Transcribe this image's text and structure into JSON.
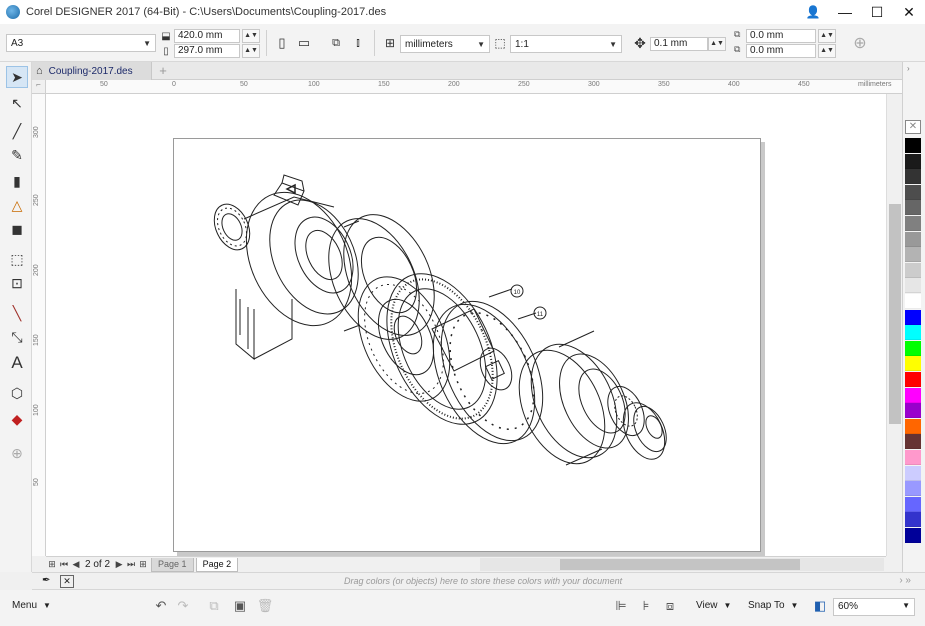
{
  "window": {
    "title": "Corel DESIGNER 2017 (64-Bit) - C:\\Users\\Documents\\Coupling-2017.des",
    "controls": {
      "minimize": "—",
      "maximize": "☐",
      "close": "✕"
    }
  },
  "property_bar": {
    "page_size": "A3",
    "width": "420.0 mm",
    "height": "297.0 mm",
    "units": "millimeters",
    "scale": "1:1",
    "nudge": "0.1 mm",
    "dup_x": "0.0 mm",
    "dup_y": "0.0 mm"
  },
  "toolbox": {
    "tools": [
      "pick-tool",
      "shape-tool",
      "line-tool",
      "artistic-media-tool",
      "fill-tool",
      "perspective-tool",
      "extrude-tool",
      "rectangle-tool",
      "crop-tool",
      "dimension-tool",
      "connector-tool",
      "text-tool",
      "projected-tool",
      "interactive-fill-tool",
      "add-tool"
    ]
  },
  "document": {
    "tab_label": "Coupling-2017.des"
  },
  "rulers": {
    "unit_label": "millimeters",
    "h_labels": [
      "50",
      "0",
      "50",
      "100",
      "150",
      "200",
      "250",
      "300",
      "350",
      "400",
      "450"
    ],
    "v_labels": [
      "300",
      "250",
      "200",
      "150",
      "100",
      "50"
    ]
  },
  "callouts": {
    "a": "10",
    "b": "11"
  },
  "page_nav": {
    "counter": "2 of 2",
    "pages": [
      "Page 1",
      "Page 2"
    ]
  },
  "color_bar": {
    "hint": "Drag colors (or objects) here to store these colors with your document"
  },
  "palette": {
    "colors": [
      "#000000",
      "#1a1a1a",
      "#333333",
      "#4d4d4d",
      "#666666",
      "#808080",
      "#999999",
      "#b3b3b3",
      "#cccccc",
      "#e6e6e6",
      "#ffffff",
      "#0000ff",
      "#00ffff",
      "#00ff00",
      "#ffff00",
      "#ff0000",
      "#ff00ff",
      "#9900cc",
      "#ff6600",
      "#663333",
      "#ff99cc",
      "#ccccff",
      "#9999ff",
      "#6666ff",
      "#3333cc",
      "#000099"
    ]
  },
  "status_bar": {
    "menu": "Menu",
    "view": "View",
    "snap_to": "Snap To",
    "zoom": "60%"
  }
}
